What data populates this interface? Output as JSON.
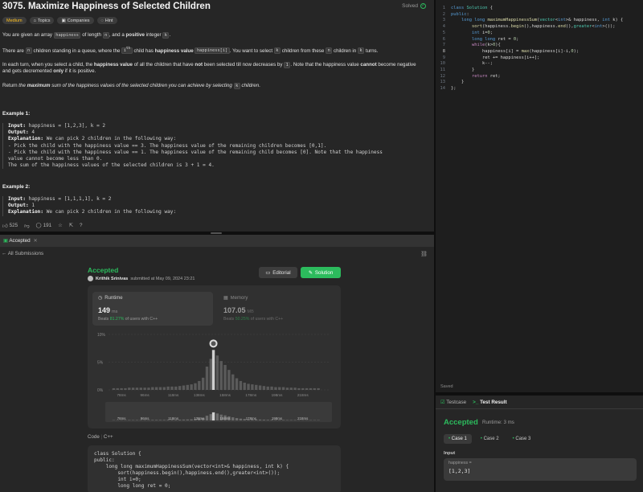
{
  "problem": {
    "title": "3075. Maximize Happiness of Selected Children",
    "solved_label": "Solved",
    "tags": [
      "Medium",
      "Topics",
      "Companies",
      "Hint"
    ],
    "p1": [
      "You are given an array ",
      "happiness",
      " of length ",
      "n",
      ", and a ",
      "positive",
      " integer ",
      "k",
      "."
    ],
    "p2": [
      "There are ",
      "n",
      " children standing in a queue, where the ",
      "i",
      "th",
      " child has ",
      "happiness value",
      " ",
      "happiness[i]",
      ". You want to select ",
      "k",
      " children from these ",
      "n",
      " children in ",
      "k",
      " turns."
    ],
    "p3": [
      "In each turn, when you select a child, the ",
      "happiness value",
      " of all the children that have ",
      "not",
      " been selected till now decreases by ",
      "1",
      ". Note that the happiness value ",
      "cannot",
      " become negative and gets decremented ",
      "only",
      " if it is positive."
    ],
    "p4": [
      "Return ",
      "the ",
      "maximum",
      " sum of the happiness values of the selected children you can achieve by selecting ",
      "k",
      " children",
      "."
    ],
    "ex1_title": "Example 1:",
    "ex1": [
      {
        "b": "Input:",
        "t": " happiness = [1,2,3], k = 2"
      },
      {
        "b": "Output:",
        "t": " 4"
      },
      {
        "b": "Explanation:",
        "t": " We can pick 2 children in the following way:"
      },
      {
        "b": "",
        "t": "- Pick the child with the happiness value == 3. The happiness value of the remaining children becomes [0,1]."
      },
      {
        "b": "",
        "t": "- Pick the child with the happiness value == 1. The happiness value of the remaining child becomes [0]. Note that the happiness"
      },
      {
        "b": "",
        "t": "value cannot become less than 0."
      },
      {
        "b": "",
        "t": "The sum of the happiness values of the selected children is 3 + 1 = 4."
      }
    ],
    "ex2_title": "Example 2:",
    "ex2": [
      {
        "b": "Input:",
        "t": " happiness = [1,1,1,1], k = 2"
      },
      {
        "b": "Output:",
        "t": " 1"
      },
      {
        "b": "Explanation:",
        "t": " We can pick 2 children in the following way:"
      }
    ],
    "likes": "525",
    "comments": "191"
  },
  "editor": {
    "lines": [
      {
        "n": "1",
        "h": "<span class='kw'>class</span> <span class='ty'>Solution</span> <span class='tx'>{</span>"
      },
      {
        "n": "2",
        "h": "<span class='kw'>public</span><span class='tx'>:</span>"
      },
      {
        "n": "3",
        "h": "    <span class='kw'>long long</span> <span class='fn'>maximumHappinessSum</span><span class='tx'>(</span><span class='ty'>vector</span><span class='tx'>&lt;</span><span class='kw'>int</span><span class='tx'>&gt;&amp; happiness, </span><span class='kw'>int</span><span class='tx'> k) {</span>"
      },
      {
        "n": "4",
        "h": "        <span class='fn'>sort</span><span class='tx'>(happiness.</span><span class='fn'>begin</span><span class='tx'>(),happiness.</span><span class='fn'>end</span><span class='tx'>(),</span><span class='ty'>greater</span><span class='tx'>&lt;</span><span class='kw'>int</span><span class='tx'>&gt;());</span>"
      },
      {
        "n": "5",
        "h": "        <span class='kw'>int</span><span class='tx'> i=</span><span class='nm'>0</span><span class='tx'>;</span>"
      },
      {
        "n": "6",
        "h": "        <span class='kw'>long long</span><span class='tx'> ret = </span><span class='nm'>0</span><span class='tx'>;</span>"
      },
      {
        "n": "7",
        "h": "        <span class='ct'>while</span><span class='tx'>(k&gt;</span><span class='nm'>0</span><span class='tx'>){</span>"
      },
      {
        "n": "8",
        "h": "            <span class='tx'>happiness[i] = </span><span class='fn'>max</span><span class='tx'>(happiness[i]-i,</span><span class='nm'>0</span><span class='tx'>);</span>",
        "active": true
      },
      {
        "n": "9",
        "h": "            <span class='tx'>ret += happiness[i++];</span>"
      },
      {
        "n": "10",
        "h": "            <span class='tx'>k--;</span>"
      },
      {
        "n": "11",
        "h": "        <span class='tx'>}</span>"
      },
      {
        "n": "12",
        "h": "        <span class='ct'>return</span><span class='tx'> ret;</span>"
      },
      {
        "n": "13",
        "h": "    <span class='tx'>}</span>"
      },
      {
        "n": "14",
        "h": "<span class='tx'>};</span>"
      }
    ],
    "saved": "Saved"
  },
  "test": {
    "tab_testcase": "Testcase",
    "tab_result": "Test Result",
    "accepted": "Accepted",
    "runtime": "Runtime: 3 ms",
    "cases": [
      "Case 1",
      "Case 2",
      "Case 3"
    ],
    "input_label": "Input",
    "var_name": "happiness =",
    "var_value": "[1,2,3]"
  },
  "submission": {
    "tab_label": "Accepted",
    "all_submissions": "All Submissions",
    "status": "Accepted",
    "author": "Krithik Srinivas",
    "submitted_at": "submitted at May 09, 2024 23:21",
    "editorial_label": "Editorial",
    "solution_label": "Solution",
    "runtime_label": "Runtime",
    "runtime_value": "149",
    "runtime_unit": "ms",
    "runtime_beats_pre": "Beats ",
    "runtime_beats": "81.27%",
    "runtime_beats_post": " of users with C++",
    "memory_label": "Memory",
    "memory_value": "107.05",
    "memory_unit": "MB",
    "memory_beats_pre": "Beats ",
    "memory_beats": "50.25%",
    "memory_beats_post": " of users with C++",
    "code_label": "Code",
    "code_lang": "C++",
    "code_text": "class Solution {\npublic:\n    long long maximumHappinessSum(vector<int>& happiness, int k) {\n        sort(happiness.begin(),happiness.end(),greater<int>());\n        int i=0;\n        long long ret = 0;"
  },
  "chart_data": {
    "type": "bar",
    "title": "",
    "ylabel": "",
    "xlabel": "",
    "y_ticks": [
      "10%",
      "5%",
      "0%"
    ],
    "ylim": [
      0,
      10
    ],
    "x_ticks": [
      "78ms",
      "96ms",
      "118ms",
      "138ms",
      "158ms",
      "178ms",
      "198ms",
      "218ms"
    ],
    "xlim": [
      68,
      238
    ],
    "highlight_bin": 149,
    "bins": [
      72,
      75,
      78,
      81,
      84,
      87,
      90,
      93,
      96,
      99,
      102,
      105,
      108,
      111,
      114,
      117,
      120,
      123,
      126,
      129,
      132,
      135,
      138,
      141,
      144,
      147,
      149,
      152,
      155,
      158,
      161,
      164,
      167,
      170,
      173,
      176,
      179,
      182,
      185,
      188,
      191,
      194,
      197,
      200,
      203,
      206,
      209,
      212,
      215,
      218,
      221,
      224,
      227,
      230
    ],
    "values": [
      0.3,
      0.3,
      0.3,
      0.3,
      0.4,
      0.4,
      0.4,
      0.4,
      0.4,
      0.4,
      0.5,
      0.5,
      0.5,
      0.5,
      0.6,
      0.6,
      0.6,
      0.7,
      0.8,
      0.9,
      1.0,
      1.2,
      1.6,
      2.2,
      4.2,
      5.6,
      7.2,
      6.2,
      5.2,
      4.5,
      3.6,
      2.8,
      2.1,
      1.6,
      1.3,
      1.1,
      1.0,
      0.9,
      0.8,
      0.7,
      0.6,
      0.6,
      0.5,
      0.5,
      0.5,
      0.4,
      0.4,
      0.4,
      0.3,
      0.3,
      0.3,
      0.3,
      0.3,
      0.3
    ],
    "colors": {
      "bar": "#5a5a5a",
      "highlight": "#cfcfcf",
      "grid": "#454545"
    }
  }
}
